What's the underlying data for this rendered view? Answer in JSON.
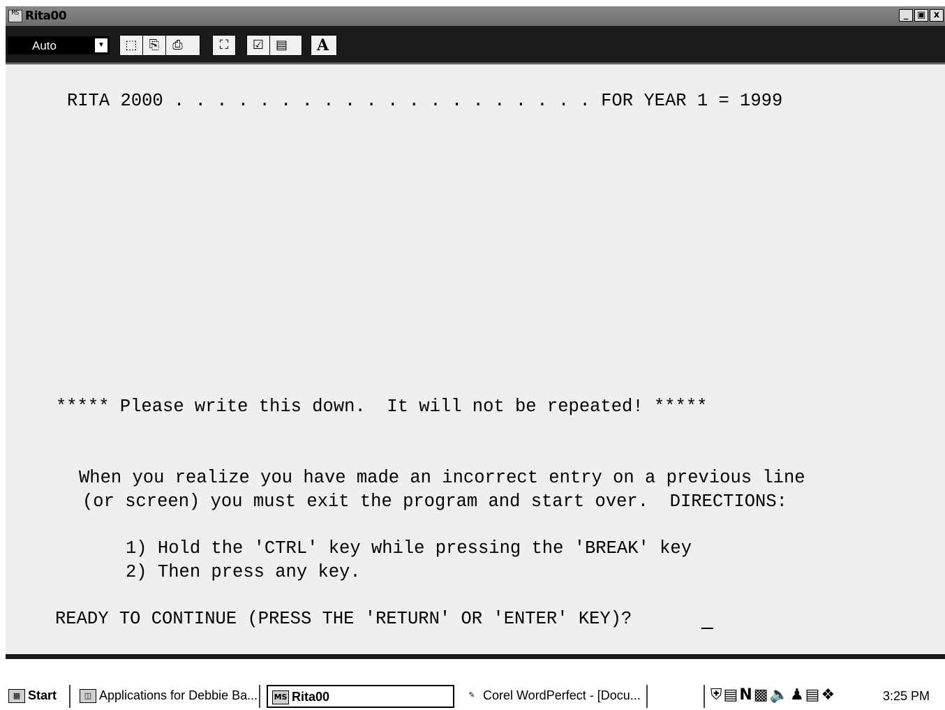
{
  "window": {
    "title": "Rita00",
    "controls": {
      "minimize": "_",
      "maximize": "\u0010",
      "close": "x"
    }
  },
  "toolbar": {
    "font_select": "Auto",
    "font_select_arrow": "▼",
    "buttons": {
      "mark": "⬚",
      "copy": "⎘",
      "paste": "⎙",
      "fullscreen": "⛶",
      "properties": "☑",
      "background": "▤",
      "font": "A"
    }
  },
  "screen": {
    "line1": "RITA 2000 . . . . . . . . . . . . . . . . . . . . FOR YEAR 1 = 1999",
    "warning": "***** Please write this down.  It will not be repeated! *****",
    "para1": "When you realize you have made an incorrect entry on a previous line",
    "para2": "(or screen) you must exit the program and start over.  DIRECTIONS:",
    "step1": "1) Hold the 'CTRL' key while pressing the 'BREAK' key",
    "step2": "2) Then press any key.",
    "prompt": "READY TO CONTINUE (PRESS THE 'RETURN' OR 'ENTER' KEY)?"
  },
  "taskbar": {
    "start": "Start",
    "tasks": [
      {
        "label": "Applications for Debbie Ba..."
      },
      {
        "label": "Rita00"
      },
      {
        "label": "Corel WordPerfect - [Docu..."
      }
    ],
    "clock": "3:25 PM"
  }
}
